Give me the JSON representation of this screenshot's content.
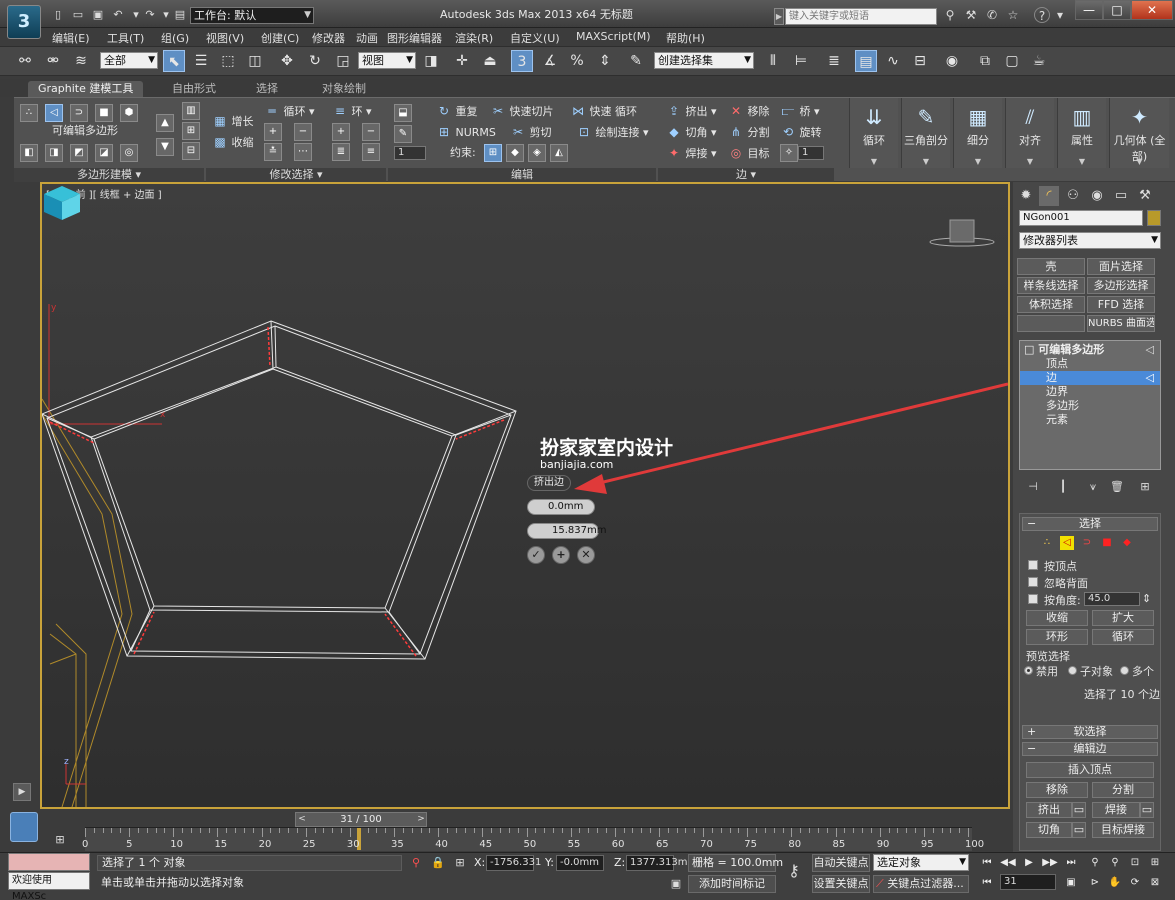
{
  "titlebar": {
    "workspace": "工作台: 默认",
    "title": "Autodesk 3ds Max  2013 x64      无标题",
    "search_placeholder": "键入关键字或短语",
    "app_logo": "3",
    "win_min": "—",
    "win_max": "□",
    "win_close": "✕",
    "help_icon": "?"
  },
  "menu": [
    "编辑(E)",
    "工具(T)",
    "组(G)",
    "视图(V)",
    "创建(C)",
    "修改器",
    "动画",
    "图形编辑器",
    "渲染(R)",
    "自定义(U)",
    "MAXScript(M)",
    "帮助(H)"
  ],
  "toolbar": {
    "selection_filter": "全部",
    "ref_coord": "视图",
    "named_selection": "创建选择集"
  },
  "ribbon": {
    "tabs": [
      "Graphite 建模工具",
      "自由形式",
      "选择",
      "对象绘制"
    ],
    "panels": {
      "poly_modeling": "多边形建模",
      "modify_selection": "修改选择",
      "edit": "编辑",
      "edges": "边"
    },
    "poly_label": "可编辑多边形",
    "mod_sel": {
      "grow": "增长",
      "shrink": "收缩",
      "loop": "循环",
      "ring": "环"
    },
    "edit": {
      "repeat": "重复",
      "quickslice": "快速切片",
      "quickloop": "快速 循环",
      "nurms": "NURMS",
      "cut": "剪切",
      "paint_connect": "绘制连接",
      "constraint": "约束:",
      "spin_value": "1"
    },
    "edges": {
      "extrude": "挤出",
      "remove": "移除",
      "bridge": "桥",
      "chamfer": "切角",
      "split": "分割",
      "turn": "旋转",
      "weld": "焊接",
      "target": "目标",
      "spin_value": "1"
    },
    "big_buttons": [
      "循环",
      "三角剖分",
      "细分",
      "对齐",
      "属性",
      "几何体 (全部)"
    ]
  },
  "viewport": {
    "label": "[ + ][ 前 ][ 线框 + 边面 ]",
    "watermark_cn": "扮家家室内设计",
    "watermark_en": "banjiajia.com",
    "axis_x": "x",
    "axis_y": "y",
    "axis_z": "z"
  },
  "caddy": {
    "title": "挤出边",
    "height": "0.0mm",
    "width": "15.837mm",
    "ok": "✓",
    "apply": "+",
    "cancel": "✕"
  },
  "command_panel": {
    "object_name": "NGon001",
    "modifier_list": "修改器列表",
    "modifier_buttons": [
      "壳",
      "面片选择",
      "样条线选择",
      "多边形选择",
      "体积选择",
      "FFD 选择",
      "",
      "NURBS 曲面选择"
    ],
    "stack": {
      "root": "可编辑多边形",
      "items": [
        "顶点",
        "边",
        "边界",
        "多边形",
        "元素"
      ],
      "selected_index": 1
    },
    "selection": {
      "title": "选择",
      "by_vertex": "按顶点",
      "ignore_back": "忽略背面",
      "by_angle": "按角度:",
      "angle_value": "45.0",
      "shrink": "收缩",
      "grow": "扩大",
      "ring": "环形",
      "loop": "循环",
      "preview_title": "预览选择",
      "preview_off": "禁用",
      "preview_sub": "子对象",
      "preview_multi": "多个",
      "status": "选择了 10 个边"
    },
    "soft_selection": "软选择",
    "edit_edges": {
      "title": "编辑边",
      "insert_vertex": "插入顶点",
      "remove": "移除",
      "split": "分割",
      "extrude": "挤出",
      "weld": "焊接",
      "chamfer": "切角",
      "target_weld": "目标焊接"
    }
  },
  "timeline": {
    "slider": "31 / 100",
    "ticks": [
      "0",
      "5",
      "10",
      "15",
      "20",
      "25",
      "30",
      "35",
      "40",
      "45",
      "50",
      "55",
      "60",
      "65",
      "70",
      "75",
      "80",
      "85",
      "90",
      "95",
      "100"
    ]
  },
  "status": {
    "maxscript": "欢迎使用 MAXSc",
    "selected": "选择了 1 个 对象",
    "prompt": "单击或单击并拖动以选择对象",
    "x_label": "X:",
    "x_value": "-1756.331",
    "y_label": "Y:",
    "y_value": "-0.0mm",
    "z_label": "Z:",
    "z_value": "1377.313m",
    "grid": "栅格 = 100.0mm",
    "auto_key": "自动关键点",
    "set_key": "设置关键点",
    "selected_obj": "选定对象",
    "key_filters": "关键点过滤器...",
    "add_time_tag": "添加时间标记",
    "frame": "31"
  },
  "colors": {
    "viewport_border": "#c9a33a",
    "selection_blue": "#4a8ad8",
    "arrow_red": "#e03a3a"
  }
}
